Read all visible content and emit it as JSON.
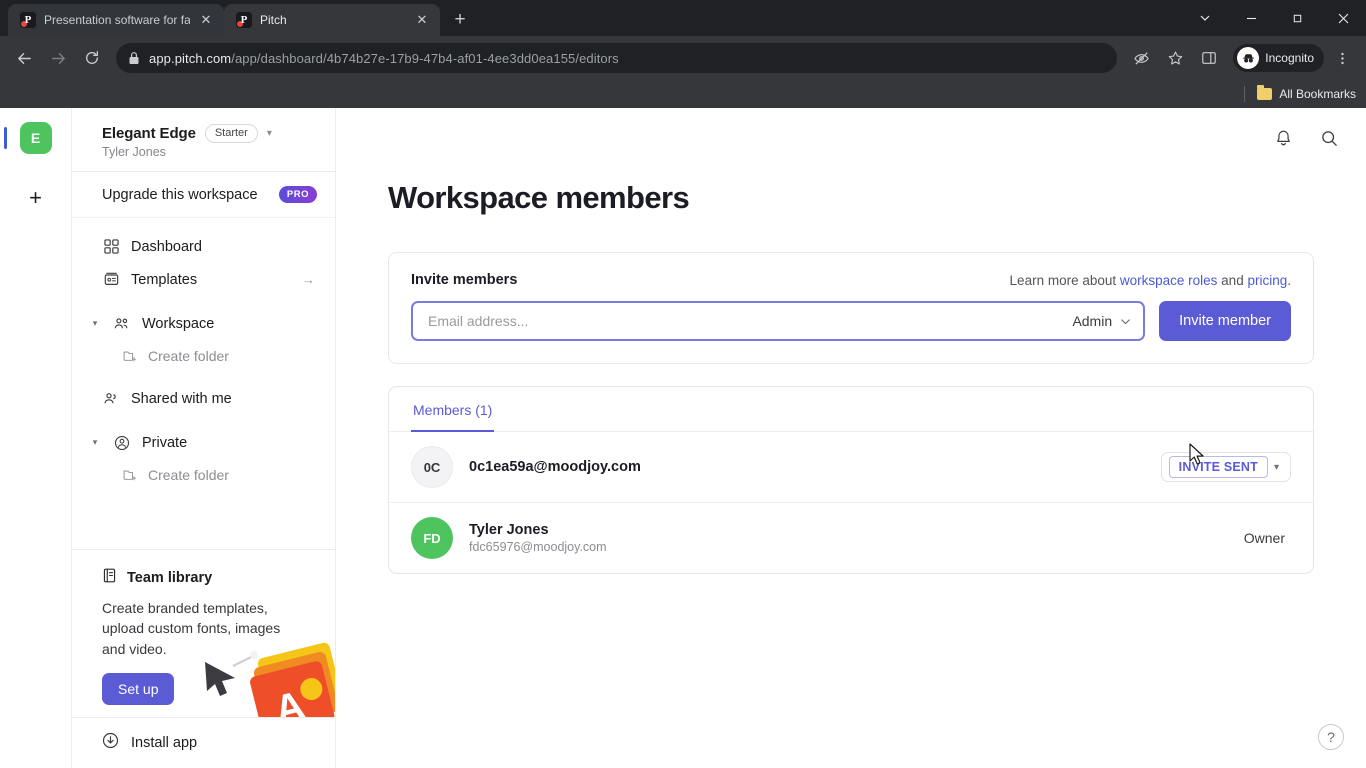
{
  "browser": {
    "tabs": [
      {
        "title": "Presentation software for fast-m",
        "favicon": "pitch-favicon",
        "active": false
      },
      {
        "title": "Pitch",
        "favicon": "pitch-favicon",
        "active": true
      }
    ],
    "new_tab_label": "+",
    "window_controls": {
      "tab_search": "tab-search-icon",
      "minimize": "minimize-icon",
      "maximize": "maximize-icon",
      "close": "close-icon"
    },
    "url": {
      "domain": "app.pitch.com",
      "path": "/app/dashboard/4b74b27e-17b9-47b4-af01-4ee3dd0ea155/editors"
    },
    "profile_label": "Incognito",
    "bookmarks": {
      "all_bookmarks_label": "All Bookmarks"
    }
  },
  "rail": {
    "workspace_initial": "E",
    "add_label": "+"
  },
  "sidebar": {
    "workspace_name": "Elegant Edge",
    "plan_badge": "Starter",
    "owner": "Tyler Jones",
    "upgrade": {
      "label": "Upgrade this workspace",
      "badge": "PRO"
    },
    "nav": [
      {
        "label": "Dashboard",
        "icon": "grid-icon"
      },
      {
        "label": "Templates",
        "icon": "templates-icon",
        "trailing": "→"
      }
    ],
    "groups": [
      {
        "label": "Workspace",
        "icon": "people-icon",
        "sub": {
          "label": "Create folder",
          "icon": "folder-plus-icon"
        }
      },
      {
        "label": "Shared with me",
        "icon": "shared-icon"
      },
      {
        "label": "Private",
        "icon": "person-circle-icon",
        "sub": {
          "label": "Create folder",
          "icon": "folder-plus-icon"
        }
      }
    ],
    "team_library": {
      "title": "Team library",
      "description": "Create branded templates, upload custom fonts, images and video.",
      "button": "Set up"
    },
    "install": {
      "label": "Install app",
      "icon": "download-icon"
    }
  },
  "topbar": {
    "notifications_icon": "bell-icon",
    "search_icon": "search-icon"
  },
  "main": {
    "page_title": "Workspace members",
    "invite": {
      "heading": "Invite members",
      "learn_prefix": "Learn more about ",
      "link_roles": "workspace roles",
      "learn_mid": " and ",
      "link_pricing": "pricing",
      "learn_suffix": ".",
      "email_placeholder": "Email address...",
      "email_value": "",
      "role_selected": "Admin",
      "submit_label": "Invite member"
    },
    "members": {
      "tab_label": "Members (1)",
      "rows": [
        {
          "avatar_initials": "0C",
          "avatar_color": "#f3f3f5",
          "name": "",
          "email": "0c1ea59a@moodjoy.com",
          "status": "INVITE SENT",
          "role": ""
        },
        {
          "avatar_initials": "FD",
          "avatar_color": "#4ec45f",
          "name": "Tyler Jones",
          "email": "fdc65976@moodjoy.com",
          "status": "",
          "role": "Owner"
        }
      ]
    },
    "help_label": "?"
  },
  "colors": {
    "accent": "#5b5bd6",
    "green": "#4ec45f",
    "link": "#4a5bd4"
  }
}
